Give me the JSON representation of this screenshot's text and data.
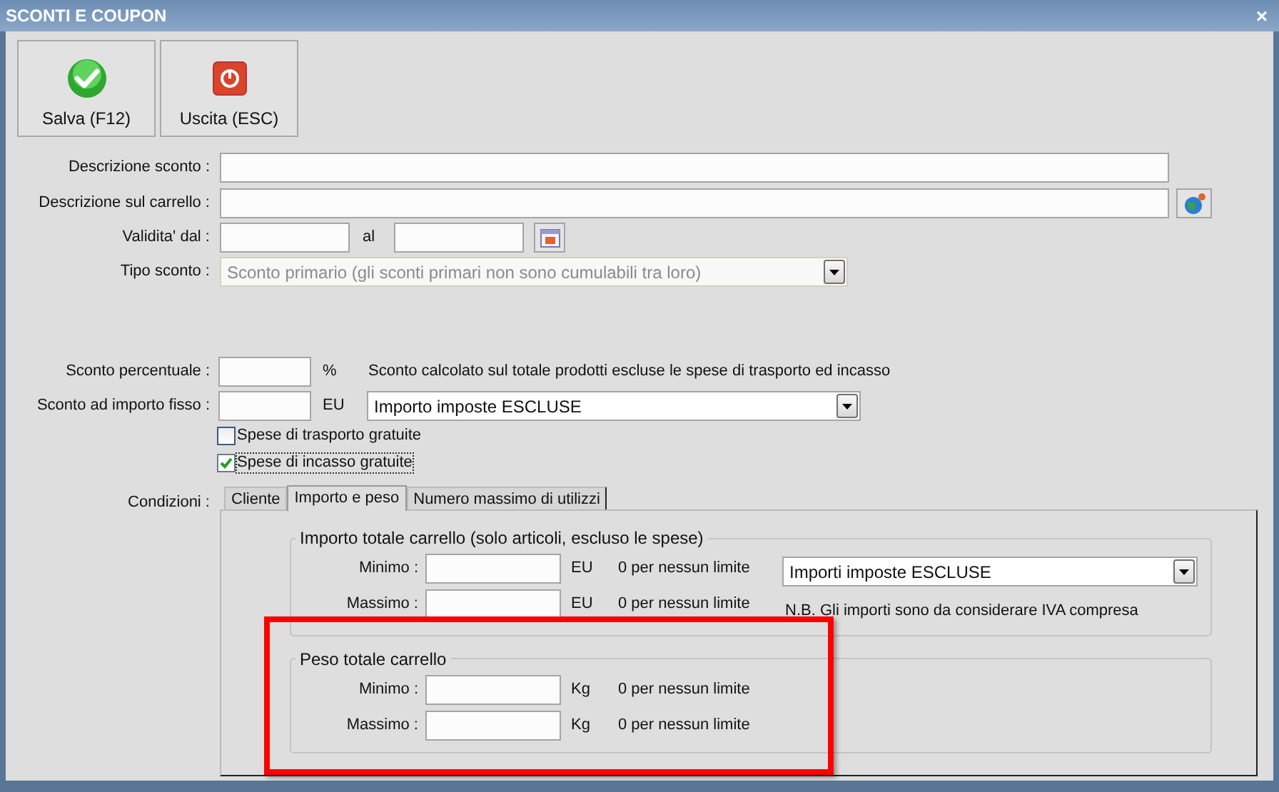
{
  "window": {
    "title": "SCONTI E COUPON",
    "close": "×"
  },
  "toolbar": [
    {
      "label": "Salva (F12)",
      "kind": "save"
    },
    {
      "label": "Uscita (ESC)",
      "kind": "exit"
    }
  ],
  "descrizione_sconto": {
    "label": "Descrizione sconto :"
  },
  "descrizione_carrello": {
    "label": "Descrizione sul carrello :"
  },
  "validita": {
    "label": "Validita' dal :",
    "separator": "al"
  },
  "tipo_sconto": {
    "label": "Tipo sconto :",
    "value": "Sconto primario (gli sconti primari non sono cumulabili tra loro)",
    "disabled": true
  },
  "sconto_percentuale": {
    "label": "Sconto percentuale :",
    "unit": "%",
    "note": "Sconto calcolato sul totale prodotti escluse le spese di trasporto ed incasso"
  },
  "sconto_importo_fisso": {
    "label": "Sconto ad importo fisso :",
    "unit": "EU",
    "select": "Importo imposte ESCLUSE"
  },
  "checkboxes": [
    {
      "label": "Spese di trasporto gratuite",
      "checked": false,
      "focused": false
    },
    {
      "label": "Spese di incasso gratuite",
      "checked": true,
      "focused": true
    }
  ],
  "conditions": {
    "label": "Condizioni :",
    "tabs": [
      {
        "label": "Cliente",
        "selected": false
      },
      {
        "label": "Importo e peso",
        "selected": true
      },
      {
        "label": "Numero massimo di utilizzi",
        "selected": false
      }
    ],
    "groups": [
      {
        "title": "Importo totale carrello (solo articoli, escluso le spese)",
        "rows": [
          {
            "label": "Minimo :",
            "unit": "EU",
            "hint": "0 per nessun limite"
          },
          {
            "label": "Massimo :",
            "unit": "EU",
            "hint": "0 per nessun limite"
          }
        ],
        "select": "Importi imposte ESCLUSE",
        "note": "N.B. Gli importi sono da considerare IVA compresa"
      },
      {
        "title": "Peso totale carrello",
        "rows": [
          {
            "label": "Minimo :",
            "unit": "Kg",
            "hint": "0 per nessun limite"
          },
          {
            "label": "Massimo :",
            "unit": "Kg",
            "hint": "0 per nessun limite"
          }
        ]
      }
    ]
  }
}
